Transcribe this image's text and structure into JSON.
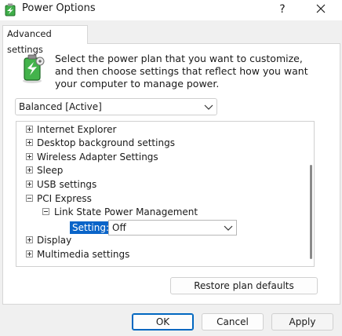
{
  "window": {
    "title": "Power Options",
    "help_glyph": "?",
    "close_icon": "close-icon"
  },
  "tab": {
    "label": "Advanced settings"
  },
  "intro": {
    "text": "Select the power plan that you want to customize, and then choose settings that reflect how you want your computer to manage power."
  },
  "plan_select": {
    "value": "Balanced [Active]"
  },
  "tree": {
    "items": [
      {
        "label": "Internet Explorer",
        "state": "collapsed"
      },
      {
        "label": "Desktop background settings",
        "state": "collapsed"
      },
      {
        "label": "Wireless Adapter Settings",
        "state": "collapsed"
      },
      {
        "label": "Sleep",
        "state": "collapsed"
      },
      {
        "label": "USB settings",
        "state": "collapsed"
      },
      {
        "label": "PCI Express",
        "state": "expanded"
      },
      {
        "label": "Link State Power Management",
        "state": "expanded"
      },
      {
        "label": "Display",
        "state": "collapsed"
      },
      {
        "label": "Multimedia settings",
        "state": "collapsed"
      }
    ],
    "setting": {
      "label": "Setting:",
      "value": "Off"
    }
  },
  "buttons": {
    "restore": "Restore plan defaults",
    "ok": "OK",
    "cancel": "Cancel",
    "apply": "Apply"
  },
  "colors": {
    "accent": "#0067c0",
    "selection": "#0a64c8"
  }
}
